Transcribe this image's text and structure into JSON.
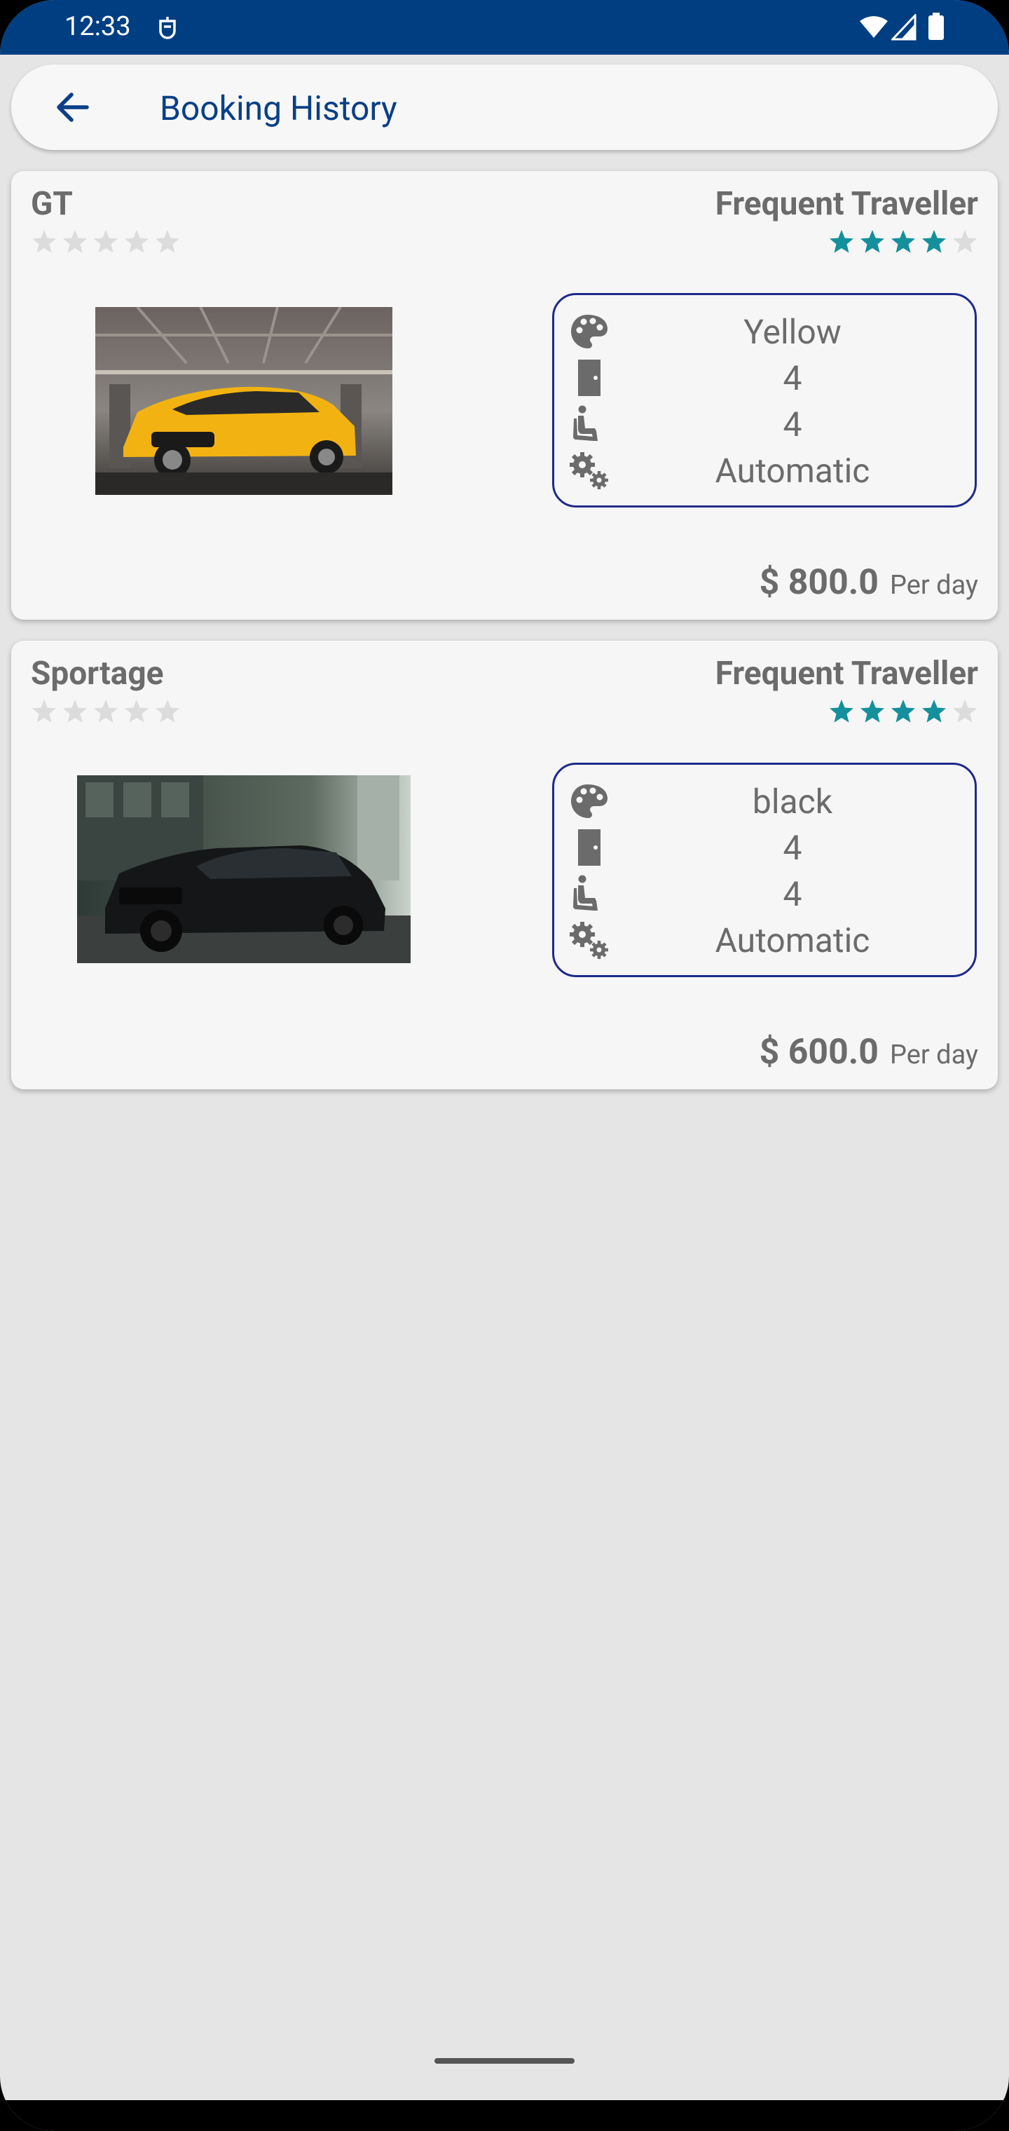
{
  "status_bar": {
    "time": "12:33",
    "icons": [
      "notification-icon",
      "wifi-icon",
      "signal-icon",
      "battery-icon"
    ]
  },
  "app_bar": {
    "title": "Booking History",
    "back_icon": "arrow-back-icon"
  },
  "colors": {
    "primary": "#003e82",
    "title": "#0a3f86",
    "star_filled": "#13909b",
    "star_empty": "#dcdcdc",
    "spec_border": "#1e2a8a",
    "text": "#6b6b6b",
    "background": "#e6e5e6"
  },
  "bookings": [
    {
      "name": "GT",
      "car_rating": 0,
      "tier": "Frequent Traveller",
      "tier_rating": 4,
      "photo_icon": "yellow-hatchback-car-photo",
      "specs": {
        "color": "Yellow",
        "doors": "4",
        "seats": "4",
        "transmission": "Automatic"
      },
      "price": "$ 800.0",
      "price_unit": "Per day"
    },
    {
      "name": "Sportage",
      "car_rating": 0,
      "tier": "Frequent Traveller",
      "tier_rating": 4,
      "photo_icon": "black-suv-car-photo",
      "specs": {
        "color": "black",
        "doors": "4",
        "seats": "4",
        "transmission": "Automatic"
      },
      "price": "$ 600.0",
      "price_unit": "Per day"
    }
  ]
}
